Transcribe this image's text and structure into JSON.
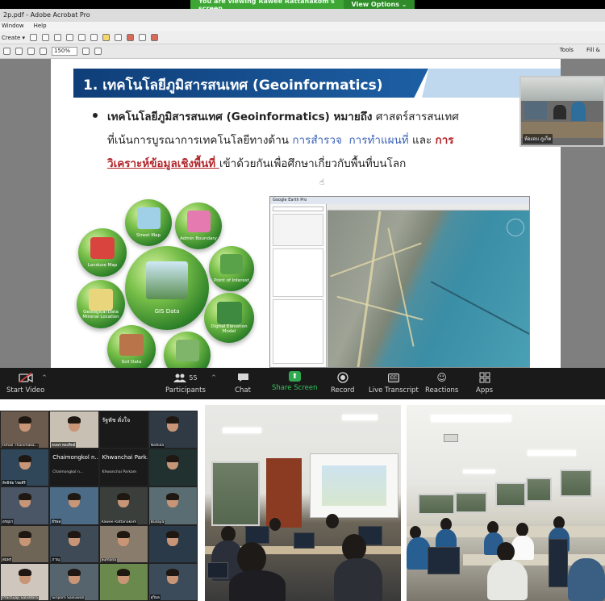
{
  "share_banner": {
    "message": "You are viewing Rawee Rattanakom's screen",
    "options_label": "View Options ⌄"
  },
  "acrobat": {
    "title": "2p.pdf - Adobe Acrobat Pro",
    "menu": [
      "Window",
      "Help"
    ],
    "create_label": "Create ▾",
    "zoom_value": "150%",
    "tools_label": "Tools",
    "fill_sign_label": "Fill &"
  },
  "slide": {
    "title": "1. เทคโนโลยีภูมิสารสนเทศ (Geoinformatics)",
    "line1_bold": "เทคโนโลยีภูมิสารสนเทศ  (Geoinformatics)  หมายถึง",
    "line1_rest": " ศาสตร์สารสนเทศ",
    "line2_a": "ที่เน้นการบูรณาการเทคโนโลยีทางด้าน  ",
    "line2_blue1": "การสำรวจ",
    "line2_blue2": "การทำแผนที่",
    "line2_and": "  และ  ",
    "line2_red": "การ",
    "line3_red": "วิเคราะห์ข้อมูลเชิงพื้นที่ ",
    "line3_rest": "เข้าด้วยกันเพื่อศึกษาเกี่ยวกับพื้นที่บนโลก",
    "spheres": [
      "Street Map",
      "Admin Boundary",
      "Landuse Map",
      "Point of Interest",
      "GIS Data",
      "Geological Data Mineral Location",
      "Digital Elevation Model",
      "Soil Data"
    ],
    "ge_title": "Google Earth Pro"
  },
  "presenter": {
    "name": "ห้องอบ ภูเก็ต"
  },
  "zoom_toolbar": {
    "start_video": "Start Video",
    "participants": "Participants",
    "participant_count": "55",
    "chat": "Chat",
    "share_screen": "Share Screen",
    "record": "Record",
    "live_transcript": "Live Transcript",
    "reactions": "Reactions",
    "apps": "Apps"
  },
  "gallery": {
    "tiles": [
      "Ismail Thanimaka...",
      "ธนพร ทองทิพย์",
      "รัฐพัช ดั่งใจ",
      "Nattida",
      "สิทธิชัย ไชยสิริ",
      "Chaimongkol n...",
      "Khwanchai Park...",
      "",
      "อรอุมา",
      "ธีรพล",
      "Rawee Rattanakom",
      "Busaya",
      "สมพร",
      "ภาณุ",
      "Sumana",
      "",
      "Prachuap Salvatora",
      "Siriporn Saisuwan",
      "",
      "สุวิมล"
    ],
    "name_big_1": "Chaimongkol n...",
    "name_big_2": "Khwanchai Park...",
    "name_mid_1": "Chaimongkol n...",
    "name_mid_2": "Khwanchai Parkam",
    "name_rat": "รัฐพัช ดั่งใจ"
  }
}
